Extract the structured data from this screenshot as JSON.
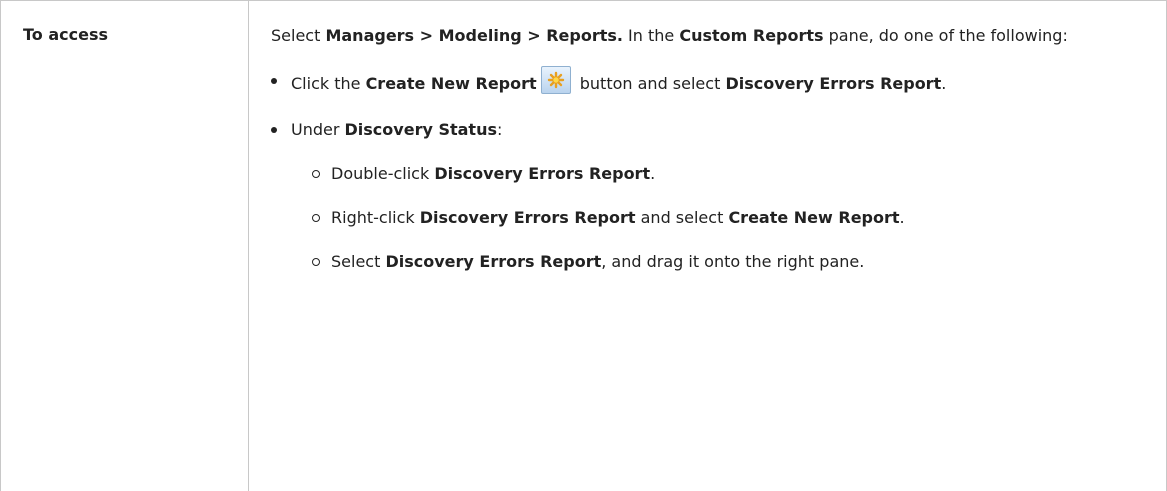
{
  "row": {
    "label": "To access"
  },
  "intro": {
    "t1": "Select ",
    "path": "Managers > Modeling > Reports.",
    "t2": " In the ",
    "pane": "Custom Reports",
    "t3": " pane, do one of the following:"
  },
  "items": [
    {
      "t1": "Click the ",
      "button": "Create New Report",
      "icon": "create-new-report-icon",
      "t2": " button and select ",
      "report": "Discovery Errors Report",
      "t3": "."
    },
    {
      "t1": "Under ",
      "status": "Discovery Status",
      "t2": ":",
      "subitems": [
        {
          "t1": "Double-click ",
          "report": "Discovery Errors Report",
          "t2": "."
        },
        {
          "t1": "Right-click ",
          "report": "Discovery Errors Report",
          "t2": " and select ",
          "action": "Create New Report",
          "t3": "."
        },
        {
          "t1": "Select ",
          "report": "Discovery Errors Report",
          "t2": ", and drag it onto the right pane."
        }
      ]
    }
  ]
}
